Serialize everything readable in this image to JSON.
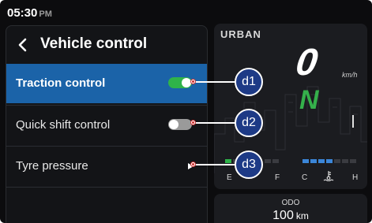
{
  "status_bar": {
    "time": "05:30",
    "ampm": "PM"
  },
  "menu": {
    "title": "Vehicle control",
    "items": [
      {
        "label": "Traction control",
        "control": "toggle",
        "state": "on",
        "active": true
      },
      {
        "label": "Quick shift control",
        "control": "toggle",
        "state": "off",
        "active": false
      },
      {
        "label": "Tyre pressure",
        "control": "chevron-right-icon",
        "active": false
      }
    ]
  },
  "dashboard": {
    "ride_mode": "URBAN",
    "speed": "0",
    "speed_unit": "km/h",
    "gear": "N",
    "fuel_empty": "E",
    "fuel_full": "F",
    "temp_cold": "C",
    "temp_hot": "H",
    "temp_icon": "coolant-temperature-icon"
  },
  "odometer": {
    "label": "ODO",
    "value": "100",
    "unit": "km"
  },
  "callouts": [
    "d1",
    "d2",
    "d3"
  ],
  "colors": {
    "accent_active": "#1b63a8",
    "toggle_on": "#2fb34a",
    "toggle_off": "#9a9a9a",
    "gear": "#35b04b",
    "callout_fill": "#1d3a86",
    "temp_bar": "#3b86d8",
    "fuel_bar": "#2fb34a"
  }
}
